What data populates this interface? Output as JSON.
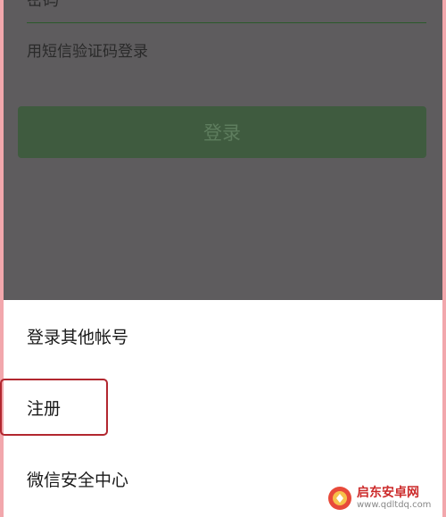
{
  "login_page": {
    "top_partial_text": "密码",
    "sms_login_link": "用短信验证码登录",
    "login_button": "登录"
  },
  "action_sheet": {
    "items": [
      {
        "label": "登录其他帐号"
      },
      {
        "label": "注册"
      },
      {
        "label": "微信安全中心"
      }
    ]
  },
  "watermark": {
    "title": "启东安卓网",
    "url": "www.qdltdq.com"
  },
  "colors": {
    "frame": "#f2a7ac",
    "overlay": "#5e5c5e",
    "button_green": "#3f5b3f",
    "highlight_red": "#b2272f"
  }
}
